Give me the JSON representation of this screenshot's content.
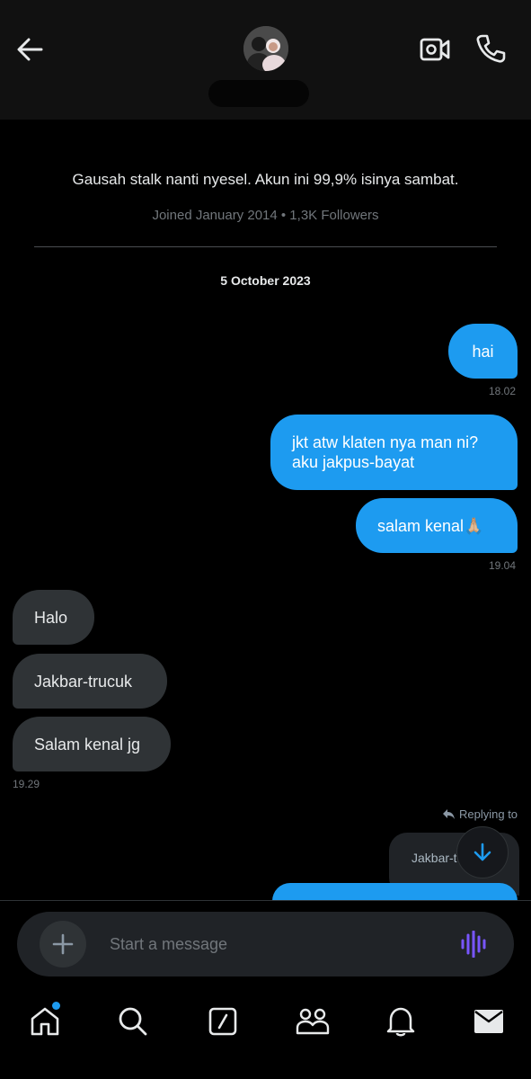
{
  "header": {
    "back_icon": "arrow-left-icon",
    "video_icon": "video-camera-icon",
    "call_icon": "phone-icon"
  },
  "profile": {
    "bio": "Gausah stalk nanti nyesel. Akun ini 99,9% isinya sambat.",
    "meta": "Joined January 2014 • 1,3K Followers"
  },
  "conversation": {
    "date": "5 October 2023",
    "messages": [
      {
        "side": "out",
        "text": "hai"
      },
      {
        "side": "out",
        "time": "18.02"
      },
      {
        "side": "out",
        "text_lines": [
          "jkt atw klaten nya man ni?",
          "aku jakpus-bayat"
        ]
      },
      {
        "side": "out",
        "text": "salam kenal🙏🏼"
      },
      {
        "side": "out",
        "time": "19.04"
      },
      {
        "side": "in",
        "text": "Halo"
      },
      {
        "side": "in",
        "text": "Jakbar-trucuk"
      },
      {
        "side": "in",
        "text": "Salam kenal jg"
      },
      {
        "side": "in",
        "time": "19.29"
      }
    ],
    "reply": {
      "label": "Replying to",
      "quoted_text": "Jakbar-t"
    }
  },
  "composer": {
    "placeholder": "Start a message",
    "add_icon": "plus-icon",
    "voice_icon": "voice-waveform-icon",
    "voice_color": "#7856ff"
  },
  "bottom_nav": {
    "items": [
      "home-icon",
      "search-icon",
      "grok-icon",
      "communities-icon",
      "notifications-icon",
      "messages-icon"
    ]
  },
  "colors": {
    "accent": "#1d9bf0",
    "background": "#000000",
    "incoming_bubble": "#2f3336"
  }
}
